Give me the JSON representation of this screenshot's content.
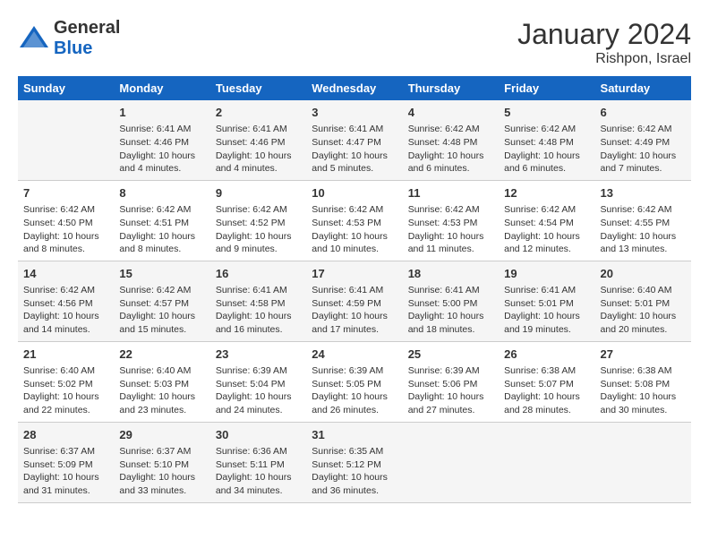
{
  "header": {
    "logo_general": "General",
    "logo_blue": "Blue",
    "title": "January 2024",
    "subtitle": "Rishpon, Israel"
  },
  "days_of_week": [
    "Sunday",
    "Monday",
    "Tuesday",
    "Wednesday",
    "Thursday",
    "Friday",
    "Saturday"
  ],
  "weeks": [
    [
      {
        "day": "",
        "content": ""
      },
      {
        "day": "1",
        "content": "Sunrise: 6:41 AM\nSunset: 4:46 PM\nDaylight: 10 hours\nand 4 minutes."
      },
      {
        "day": "2",
        "content": "Sunrise: 6:41 AM\nSunset: 4:46 PM\nDaylight: 10 hours\nand 4 minutes."
      },
      {
        "day": "3",
        "content": "Sunrise: 6:41 AM\nSunset: 4:47 PM\nDaylight: 10 hours\nand 5 minutes."
      },
      {
        "day": "4",
        "content": "Sunrise: 6:42 AM\nSunset: 4:48 PM\nDaylight: 10 hours\nand 6 minutes."
      },
      {
        "day": "5",
        "content": "Sunrise: 6:42 AM\nSunset: 4:48 PM\nDaylight: 10 hours\nand 6 minutes."
      },
      {
        "day": "6",
        "content": "Sunrise: 6:42 AM\nSunset: 4:49 PM\nDaylight: 10 hours\nand 7 minutes."
      }
    ],
    [
      {
        "day": "7",
        "content": "Sunrise: 6:42 AM\nSunset: 4:50 PM\nDaylight: 10 hours\nand 8 minutes."
      },
      {
        "day": "8",
        "content": "Sunrise: 6:42 AM\nSunset: 4:51 PM\nDaylight: 10 hours\nand 8 minutes."
      },
      {
        "day": "9",
        "content": "Sunrise: 6:42 AM\nSunset: 4:52 PM\nDaylight: 10 hours\nand 9 minutes."
      },
      {
        "day": "10",
        "content": "Sunrise: 6:42 AM\nSunset: 4:53 PM\nDaylight: 10 hours\nand 10 minutes."
      },
      {
        "day": "11",
        "content": "Sunrise: 6:42 AM\nSunset: 4:53 PM\nDaylight: 10 hours\nand 11 minutes."
      },
      {
        "day": "12",
        "content": "Sunrise: 6:42 AM\nSunset: 4:54 PM\nDaylight: 10 hours\nand 12 minutes."
      },
      {
        "day": "13",
        "content": "Sunrise: 6:42 AM\nSunset: 4:55 PM\nDaylight: 10 hours\nand 13 minutes."
      }
    ],
    [
      {
        "day": "14",
        "content": "Sunrise: 6:42 AM\nSunset: 4:56 PM\nDaylight: 10 hours\nand 14 minutes."
      },
      {
        "day": "15",
        "content": "Sunrise: 6:42 AM\nSunset: 4:57 PM\nDaylight: 10 hours\nand 15 minutes."
      },
      {
        "day": "16",
        "content": "Sunrise: 6:41 AM\nSunset: 4:58 PM\nDaylight: 10 hours\nand 16 minutes."
      },
      {
        "day": "17",
        "content": "Sunrise: 6:41 AM\nSunset: 4:59 PM\nDaylight: 10 hours\nand 17 minutes."
      },
      {
        "day": "18",
        "content": "Sunrise: 6:41 AM\nSunset: 5:00 PM\nDaylight: 10 hours\nand 18 minutes."
      },
      {
        "day": "19",
        "content": "Sunrise: 6:41 AM\nSunset: 5:01 PM\nDaylight: 10 hours\nand 19 minutes."
      },
      {
        "day": "20",
        "content": "Sunrise: 6:40 AM\nSunset: 5:01 PM\nDaylight: 10 hours\nand 20 minutes."
      }
    ],
    [
      {
        "day": "21",
        "content": "Sunrise: 6:40 AM\nSunset: 5:02 PM\nDaylight: 10 hours\nand 22 minutes."
      },
      {
        "day": "22",
        "content": "Sunrise: 6:40 AM\nSunset: 5:03 PM\nDaylight: 10 hours\nand 23 minutes."
      },
      {
        "day": "23",
        "content": "Sunrise: 6:39 AM\nSunset: 5:04 PM\nDaylight: 10 hours\nand 24 minutes."
      },
      {
        "day": "24",
        "content": "Sunrise: 6:39 AM\nSunset: 5:05 PM\nDaylight: 10 hours\nand 26 minutes."
      },
      {
        "day": "25",
        "content": "Sunrise: 6:39 AM\nSunset: 5:06 PM\nDaylight: 10 hours\nand 27 minutes."
      },
      {
        "day": "26",
        "content": "Sunrise: 6:38 AM\nSunset: 5:07 PM\nDaylight: 10 hours\nand 28 minutes."
      },
      {
        "day": "27",
        "content": "Sunrise: 6:38 AM\nSunset: 5:08 PM\nDaylight: 10 hours\nand 30 minutes."
      }
    ],
    [
      {
        "day": "28",
        "content": "Sunrise: 6:37 AM\nSunset: 5:09 PM\nDaylight: 10 hours\nand 31 minutes."
      },
      {
        "day": "29",
        "content": "Sunrise: 6:37 AM\nSunset: 5:10 PM\nDaylight: 10 hours\nand 33 minutes."
      },
      {
        "day": "30",
        "content": "Sunrise: 6:36 AM\nSunset: 5:11 PM\nDaylight: 10 hours\nand 34 minutes."
      },
      {
        "day": "31",
        "content": "Sunrise: 6:35 AM\nSunset: 5:12 PM\nDaylight: 10 hours\nand 36 minutes."
      },
      {
        "day": "",
        "content": ""
      },
      {
        "day": "",
        "content": ""
      },
      {
        "day": "",
        "content": ""
      }
    ]
  ]
}
